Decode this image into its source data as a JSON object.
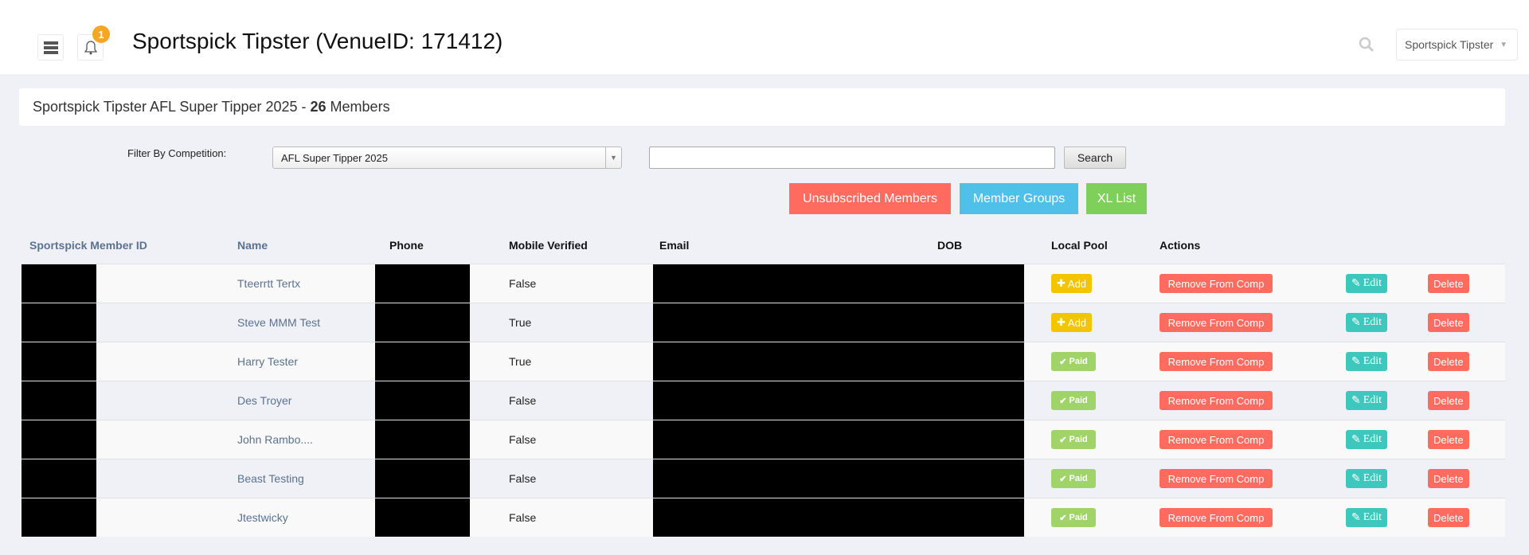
{
  "header": {
    "title": "Sportspick Tipster (VenueID: 171412)",
    "notification_count": "1",
    "user_menu": "Sportspick Tipster"
  },
  "summary": {
    "prefix": "Sportspick Tipster AFL Super Tipper 2025 - ",
    "count": "26",
    "suffix": " Members"
  },
  "filter": {
    "label": "Filter By Competition:",
    "selected": "AFL Super Tipper 2025",
    "search_value": "",
    "search_button": "Search"
  },
  "buttons": {
    "unsubscribed": "Unsubscribed Members",
    "groups": "Member Groups",
    "xl": "XL List"
  },
  "colors": {
    "unsubscribed": "#ff6b5f",
    "groups": "#4fc1e9",
    "xl": "#7ed05a"
  },
  "table": {
    "headers": [
      "Sportspick Member ID",
      "Name",
      "Phone",
      "Mobile Verified",
      "Email",
      "DOB",
      "Local Pool",
      "Actions"
    ],
    "rows": [
      {
        "name": "Tteerrtt Tertx",
        "verified": "False",
        "pool": "Add"
      },
      {
        "name": "Steve MMM Test",
        "verified": "True",
        "pool": "Add"
      },
      {
        "name": "Harry Tester",
        "verified": "True",
        "pool": "Paid"
      },
      {
        "name": "Des Troyer",
        "verified": "False",
        "pool": "Paid"
      },
      {
        "name": "John Rambo....",
        "verified": "False",
        "pool": "Paid"
      },
      {
        "name": "Beast Testing",
        "verified": "False",
        "pool": "Paid"
      },
      {
        "name": "Jtestwicky",
        "verified": "False",
        "pool": "Paid"
      }
    ],
    "actions": {
      "remove": "Remove From Comp",
      "edit": "Edit",
      "delete": "Delete"
    }
  }
}
